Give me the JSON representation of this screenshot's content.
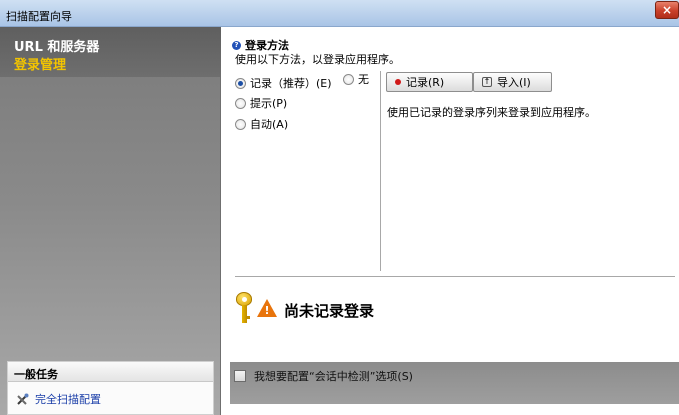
{
  "window": {
    "title": "扫描配置向导",
    "close_glyph": "×"
  },
  "sidebar": {
    "items": [
      {
        "label": "URL 和服务器",
        "color": "#ffffff"
      },
      {
        "label": "登录管理",
        "color": "#f2c400"
      }
    ],
    "tasks": {
      "header": "一般任务",
      "items": [
        {
          "label": "完全扫描配置",
          "icon": "tools-icon"
        }
      ]
    }
  },
  "main": {
    "section_title": "登录方法",
    "section_desc": "使用以下方法，以登录应用程序。",
    "methods": [
      {
        "label": "记录（推荐）(E)",
        "checked": true
      },
      {
        "label": "无",
        "checked": false
      },
      {
        "label": "提示(P)",
        "checked": false
      },
      {
        "label": "自动(A)",
        "checked": false
      }
    ],
    "buttons": {
      "record_label": "记录(R)",
      "import_label": "导入(I)"
    },
    "help_text": "使用已记录的登录序列来登录到应用程序。",
    "status_text": "尚未记录登录",
    "checkbox_label": "我想要配置“会话中检测”选项(S)",
    "checkbox_checked": false
  },
  "colors": {
    "accent": "#f2c400",
    "link": "#1a3ea8",
    "record_dot": "#d01818",
    "warning": "#e8740c"
  }
}
